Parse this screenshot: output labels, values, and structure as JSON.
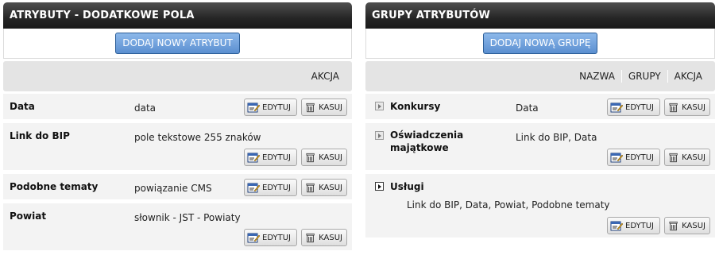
{
  "attributes": {
    "title": "ATRYBUTY - DODATKOWE POLA",
    "add_button": "DODAJ NOWY ATRYBUT",
    "col_action": "AKCJA",
    "rows": [
      {
        "name": "Data",
        "value": "data"
      },
      {
        "name": "Link do BIP",
        "value": "pole tekstowe 255 znaków"
      },
      {
        "name": "Podobne tematy",
        "value": "powiązanie CMS"
      },
      {
        "name": "Powiat",
        "value": "słownik - JST - Powiaty"
      }
    ]
  },
  "groups": {
    "title": "GRUPY ATRYBUTÓW",
    "add_button": "DODAJ NOWĄ GRUPĘ",
    "col_name": "NAZWA",
    "col_groups": "GRUPY",
    "col_action": "AKCJA",
    "rows": [
      {
        "name": "Konkursy",
        "value": "Data"
      },
      {
        "name_line1": "Oświadczenia",
        "name_line2": "majątkowe",
        "value": "Link do BIP, Data"
      },
      {
        "name": "Usługi",
        "value": "Link do BIP, Data, Powiat, Podobne tematy"
      }
    ]
  },
  "buttons": {
    "edit": "EDYTUJ",
    "delete": "KASUJ"
  },
  "icons": {
    "edit": "edit-icon",
    "delete": "trash-icon",
    "expand": "expand-arrow-icon"
  },
  "colors": {
    "header": "#262626",
    "accent_button": "#5b8fd0",
    "row_bg": "#f3f3f3"
  }
}
